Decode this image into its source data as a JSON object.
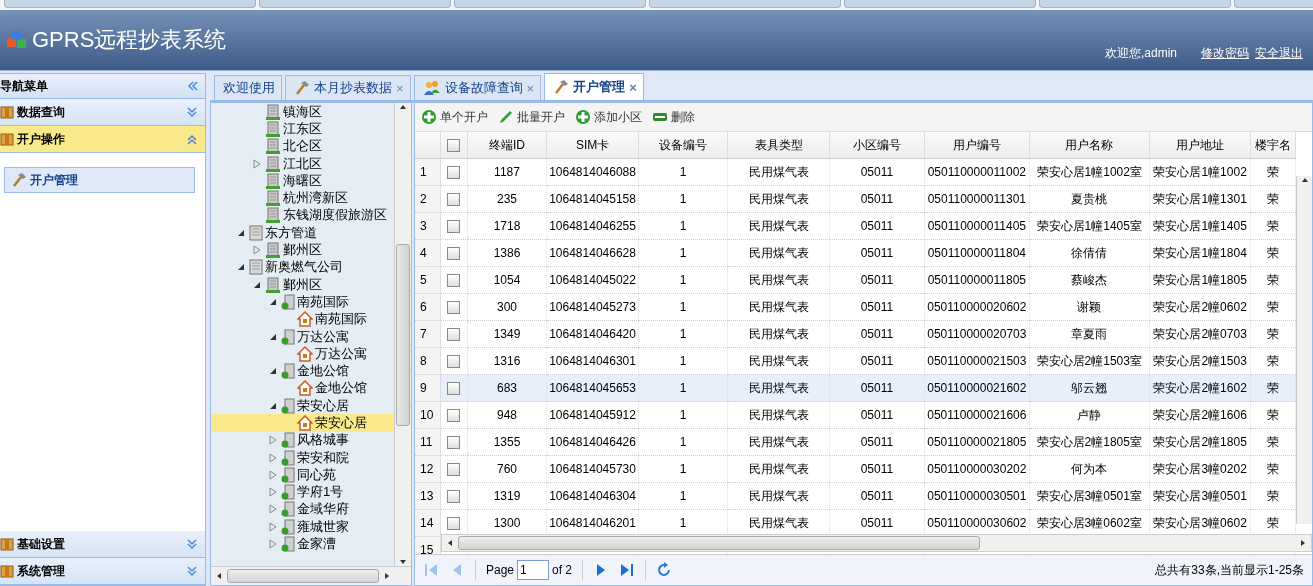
{
  "header": {
    "title": "GPRS远程抄表系统",
    "welcome": "欢迎您,admin",
    "links": [
      "修改密码",
      "安全退出"
    ]
  },
  "nav": {
    "title": "导航菜单",
    "sections": [
      {
        "title": "数据查询",
        "expanded": false,
        "selected": false
      },
      {
        "title": "开户操作",
        "expanded": true,
        "selected": true,
        "items": [
          {
            "label": "开户管理",
            "selected": true
          }
        ]
      },
      {
        "title": "基础设置",
        "expanded": false,
        "selected": false
      },
      {
        "title": "系统管理",
        "expanded": false,
        "selected": false
      }
    ]
  },
  "tabs": [
    {
      "label": "欢迎使用",
      "kind": "plain",
      "selected": false
    },
    {
      "label": "本月抄表数据",
      "kind": "tool",
      "close": "×",
      "selected": false
    },
    {
      "label": "设备故障查询",
      "kind": "people",
      "close": "×",
      "selected": false
    },
    {
      "label": "开户管理",
      "kind": "tool",
      "close": "×",
      "selected": true
    }
  ],
  "tree": {
    "orphans": [
      {
        "label": "镇海区",
        "kind": "district",
        "selected": false
      },
      {
        "label": "江东区",
        "kind": "district",
        "selected": false
      },
      {
        "label": "北仑区",
        "kind": "district",
        "selected": false
      },
      {
        "label": "江北区",
        "kind": "district",
        "selected": false,
        "expanded": false
      },
      {
        "label": "海曙区",
        "kind": "district",
        "selected": false
      },
      {
        "label": "杭州湾新区",
        "kind": "district",
        "selected": false
      },
      {
        "label": "东钱湖度假旅游区",
        "kind": "district",
        "selected": false
      }
    ],
    "items": [
      {
        "label": "东方管道",
        "kind": "company",
        "selected": false,
        "expanded": true,
        "children": [
          {
            "label": "鄞州区",
            "kind": "district",
            "selected": false,
            "expanded": false
          }
        ]
      },
      {
        "label": "新奥燃气公司",
        "kind": "company",
        "selected": false,
        "expanded": true,
        "children": [
          {
            "label": "鄞州区",
            "kind": "district",
            "selected": false,
            "expanded": true,
            "children": [
              {
                "label": "南苑国际",
                "kind": "estate",
                "selected": false,
                "expanded": true,
                "children": [
                  {
                    "label": "南苑国际",
                    "kind": "house",
                    "selected": false
                  }
                ]
              },
              {
                "label": "万达公寓",
                "kind": "estate",
                "selected": false,
                "expanded": true,
                "children": [
                  {
                    "label": "万达公寓",
                    "kind": "house",
                    "selected": false
                  }
                ]
              },
              {
                "label": "金地公馆",
                "kind": "estate",
                "selected": false,
                "expanded": true,
                "children": [
                  {
                    "label": "金地公馆",
                    "kind": "house",
                    "selected": false
                  }
                ]
              },
              {
                "label": "荣安心居",
                "kind": "estate",
                "selected": false,
                "expanded": true,
                "children": [
                  {
                    "label": "荣安心居",
                    "kind": "house",
                    "selected": true
                  }
                ]
              },
              {
                "label": "风格城事",
                "kind": "estate",
                "selected": false,
                "expanded": false
              },
              {
                "label": "荣安和院",
                "kind": "estate",
                "selected": false,
                "expanded": false
              },
              {
                "label": "同心苑",
                "kind": "estate",
                "selected": false,
                "expanded": false
              },
              {
                "label": "学府1号",
                "kind": "estate",
                "selected": false,
                "expanded": false
              },
              {
                "label": "金域华府",
                "kind": "estate",
                "selected": false,
                "expanded": false
              },
              {
                "label": "雍城世家",
                "kind": "estate",
                "selected": false,
                "expanded": false
              },
              {
                "label": "金家漕",
                "kind": "estate",
                "selected": false,
                "expanded": false
              }
            ]
          }
        ]
      }
    ]
  },
  "toolbar": [
    {
      "label": "单个开户",
      "kind": "add"
    },
    {
      "label": "批量开户",
      "kind": "edit"
    },
    {
      "label": "添加小区",
      "kind": "add"
    },
    {
      "label": "删除",
      "kind": "remove"
    }
  ],
  "table": {
    "select_all_checked": false,
    "columns": [
      "终端ID",
      "SIM卡",
      "设备编号",
      "表具类型",
      "小区编号",
      "用户编号",
      "用户名称",
      "用户地址",
      "楼宇名"
    ],
    "rows": [
      {
        "num": "1",
        "checked": false,
        "selected": false,
        "cells": [
          "1187",
          "1064814046088",
          "1",
          "民用煤气表",
          "05011",
          "050110000011002",
          "荣安心居1幢1002室",
          "荣安心居1幢1002",
          "荣"
        ]
      },
      {
        "num": "2",
        "checked": false,
        "selected": false,
        "cells": [
          "235",
          "1064814045158",
          "1",
          "民用煤气表",
          "05011",
          "050110000011301",
          "夏贵桃",
          "荣安心居1幢1301",
          "荣"
        ]
      },
      {
        "num": "3",
        "checked": false,
        "selected": false,
        "cells": [
          "1718",
          "1064814046255",
          "1",
          "民用煤气表",
          "05011",
          "050110000011405",
          "荣安心居1幢1405室",
          "荣安心居1幢1405",
          "荣"
        ]
      },
      {
        "num": "4",
        "checked": false,
        "selected": false,
        "cells": [
          "1386",
          "1064814046628",
          "1",
          "民用煤气表",
          "05011",
          "050110000011804",
          "徐倩倩",
          "荣安心居1幢1804",
          "荣"
        ]
      },
      {
        "num": "5",
        "checked": false,
        "selected": false,
        "cells": [
          "1054",
          "1064814045022",
          "1",
          "民用煤气表",
          "05011",
          "050110000011805",
          "蔡峻杰",
          "荣安心居1幢1805",
          "荣"
        ]
      },
      {
        "num": "6",
        "checked": false,
        "selected": false,
        "cells": [
          "300",
          "1064814045273",
          "1",
          "民用煤气表",
          "05011",
          "050110000020602",
          "谢颖",
          "荣安心居2幢0602",
          "荣"
        ]
      },
      {
        "num": "7",
        "checked": false,
        "selected": false,
        "cells": [
          "1349",
          "1064814046420",
          "1",
          "民用煤气表",
          "05011",
          "050110000020703",
          "章夏雨",
          "荣安心居2幢0703",
          "荣"
        ]
      },
      {
        "num": "8",
        "checked": false,
        "selected": false,
        "cells": [
          "1316",
          "1064814046301",
          "1",
          "民用煤气表",
          "05011",
          "050110000021503",
          "荣安心居2幢1503室",
          "荣安心居2幢1503",
          "荣"
        ]
      },
      {
        "num": "9",
        "checked": false,
        "selected": true,
        "cells": [
          "683",
          "1064814045653",
          "1",
          "民用煤气表",
          "05011",
          "050110000021602",
          "邬云翘",
          "荣安心居2幢1602",
          "荣"
        ]
      },
      {
        "num": "10",
        "checked": false,
        "selected": false,
        "cells": [
          "948",
          "1064814045912",
          "1",
          "民用煤气表",
          "05011",
          "050110000021606",
          "卢静",
          "荣安心居2幢1606",
          "荣"
        ]
      },
      {
        "num": "11",
        "checked": false,
        "selected": false,
        "cells": [
          "1355",
          "1064814046426",
          "1",
          "民用煤气表",
          "05011",
          "050110000021805",
          "荣安心居2幢1805室",
          "荣安心居2幢1805",
          "荣"
        ]
      },
      {
        "num": "12",
        "checked": false,
        "selected": false,
        "cells": [
          "760",
          "1064814045730",
          "1",
          "民用煤气表",
          "05011",
          "050110000030202",
          "何为本",
          "荣安心居3幢0202",
          "荣"
        ]
      },
      {
        "num": "13",
        "checked": false,
        "selected": false,
        "cells": [
          "1319",
          "1064814046304",
          "1",
          "民用煤气表",
          "05011",
          "050110000030501",
          "荣安心居3幢0501室",
          "荣安心居3幢0501",
          "荣"
        ]
      },
      {
        "num": "14",
        "checked": false,
        "selected": false,
        "cells": [
          "1300",
          "1064814046201",
          "1",
          "民用煤气表",
          "05011",
          "050110000030602",
          "荣安心居3幢0602室",
          "荣安心居3幢0602",
          "荣"
        ]
      }
    ],
    "partial_row_num": "15"
  },
  "pager": {
    "page_label": "Page",
    "page": "1",
    "of": "of 2",
    "summary": "总共有33条,当前显示1-25条"
  }
}
